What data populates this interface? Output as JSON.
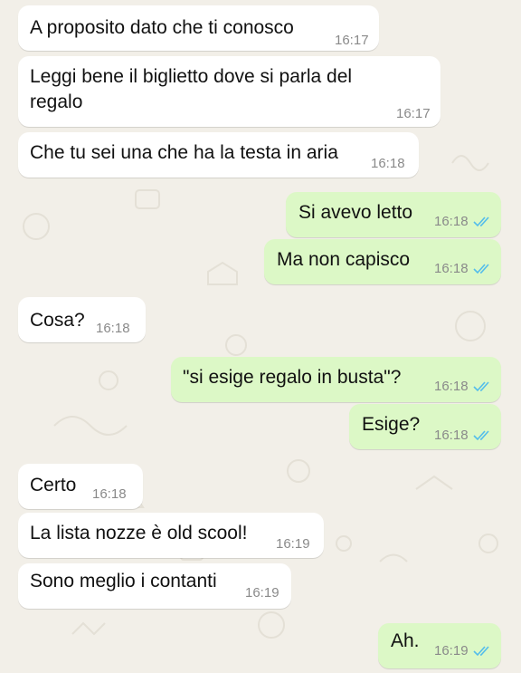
{
  "colors": {
    "wallpaper": "#f2efe8",
    "incoming_bubble": "#ffffff",
    "outgoing_bubble": "#dcf8c6",
    "read_ticks": "#53bdeb",
    "timestamp": "#8a8a8a"
  },
  "messages": [
    {
      "direction": "in",
      "text": "A proposito dato che ti conosco",
      "time": "16:17"
    },
    {
      "direction": "in",
      "text_line1": "Leggi bene il biglietto dove si parla del",
      "text_line2": "regalo",
      "time": "16:17"
    },
    {
      "direction": "in",
      "text": "Che tu sei una che ha la testa in aria",
      "time": "16:18"
    },
    {
      "direction": "out",
      "text": "Si avevo letto",
      "time": "16:18",
      "status_icon": "double-check-read-icon"
    },
    {
      "direction": "out",
      "text": "Ma non capisco",
      "time": "16:18",
      "status_icon": "double-check-read-icon"
    },
    {
      "direction": "in",
      "text": "Cosa?",
      "time": "16:18"
    },
    {
      "direction": "out",
      "text": "\"si esige regalo in busta\"?",
      "time": "16:18",
      "status_icon": "double-check-read-icon"
    },
    {
      "direction": "out",
      "text": "Esige?",
      "time": "16:18",
      "status_icon": "double-check-read-icon"
    },
    {
      "direction": "in",
      "text": "Certo",
      "time": "16:18"
    },
    {
      "direction": "in",
      "text": "La lista nozze è old scool!",
      "time": "16:19"
    },
    {
      "direction": "in",
      "text": "Sono meglio i contanti",
      "time": "16:19"
    },
    {
      "direction": "out",
      "text": "Ah.",
      "time": "16:19",
      "status_icon": "double-check-read-icon"
    }
  ]
}
